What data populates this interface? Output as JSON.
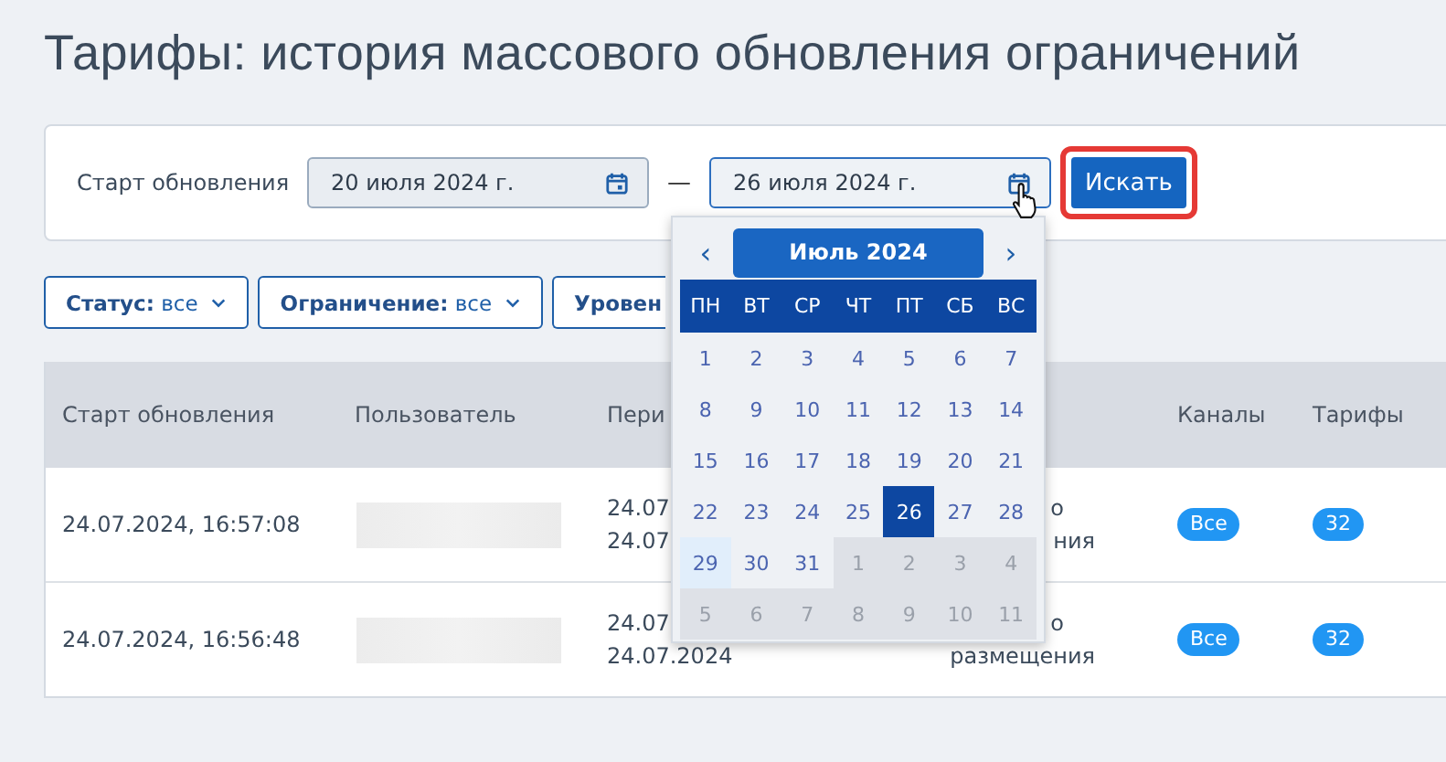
{
  "title": "Тарифы: история массового обновления ограничений",
  "search": {
    "label": "Старт обновления",
    "from": "20 июля 2024 г.",
    "to": "26 июля 2024 г.",
    "to_focused": true,
    "dash": "—",
    "button": "Искать",
    "button_highlighted": true
  },
  "filters": [
    {
      "label": "Статус:",
      "value": "все"
    },
    {
      "label": "Ограничение:",
      "value": "все"
    },
    {
      "label": "Уровен"
    }
  ],
  "table": {
    "columns": [
      "Старт обновления",
      "Пользователь",
      "Пери",
      "",
      "Каналы",
      "Тарифы"
    ],
    "rows": [
      {
        "start": "24.07.2024, 16:57:08",
        "user_blurred": true,
        "period": [
          "24.07",
          "24.07"
        ],
        "restriction": [
          "о",
          "ния"
        ],
        "channels": "Все",
        "tariffs": "32"
      },
      {
        "start": "24.07.2024, 16:56:48",
        "user_blurred": true,
        "period": [
          "24.07",
          "24.07.2024"
        ],
        "restriction": [
          "о",
          "размещения"
        ],
        "channels": "Все",
        "tariffs": "32"
      }
    ]
  },
  "calendar": {
    "prev": "‹",
    "month": "Июль 2024",
    "next": "›",
    "weekdays": [
      "ПН",
      "ВТ",
      "СР",
      "ЧТ",
      "ПТ",
      "СБ",
      "ВС"
    ],
    "weeks": [
      [
        {
          "day": "1",
          "outside": false,
          "selected": false,
          "today": false
        },
        {
          "day": "2",
          "outside": false,
          "selected": false,
          "today": false
        },
        {
          "day": "3",
          "outside": false,
          "selected": false,
          "today": false
        },
        {
          "day": "4",
          "outside": false,
          "selected": false,
          "today": false
        },
        {
          "day": "5",
          "outside": false,
          "selected": false,
          "today": false
        },
        {
          "day": "6",
          "outside": false,
          "selected": false,
          "today": false
        },
        {
          "day": "7",
          "outside": false,
          "selected": false,
          "today": false
        }
      ],
      [
        {
          "day": "8",
          "outside": false,
          "selected": false,
          "today": false
        },
        {
          "day": "9",
          "outside": false,
          "selected": false,
          "today": false
        },
        {
          "day": "10",
          "outside": false,
          "selected": false,
          "today": false
        },
        {
          "day": "11",
          "outside": false,
          "selected": false,
          "today": false
        },
        {
          "day": "12",
          "outside": false,
          "selected": false,
          "today": false
        },
        {
          "day": "13",
          "outside": false,
          "selected": false,
          "today": false
        },
        {
          "day": "14",
          "outside": false,
          "selected": false,
          "today": false
        }
      ],
      [
        {
          "day": "15",
          "outside": false,
          "selected": false,
          "today": false
        },
        {
          "day": "16",
          "outside": false,
          "selected": false,
          "today": false
        },
        {
          "day": "17",
          "outside": false,
          "selected": false,
          "today": false
        },
        {
          "day": "18",
          "outside": false,
          "selected": false,
          "today": false
        },
        {
          "day": "19",
          "outside": false,
          "selected": false,
          "today": false
        },
        {
          "day": "20",
          "outside": false,
          "selected": false,
          "today": false
        },
        {
          "day": "21",
          "outside": false,
          "selected": false,
          "today": false
        }
      ],
      [
        {
          "day": "22",
          "outside": false,
          "selected": false,
          "today": false
        },
        {
          "day": "23",
          "outside": false,
          "selected": false,
          "today": false
        },
        {
          "day": "24",
          "outside": false,
          "selected": false,
          "today": false
        },
        {
          "day": "25",
          "outside": false,
          "selected": false,
          "today": false
        },
        {
          "day": "26",
          "outside": false,
          "selected": true,
          "today": false
        },
        {
          "day": "27",
          "outside": false,
          "selected": false,
          "today": false
        },
        {
          "day": "28",
          "outside": false,
          "selected": false,
          "today": false
        }
      ],
      [
        {
          "day": "29",
          "outside": false,
          "selected": false,
          "today": true
        },
        {
          "day": "30",
          "outside": false,
          "selected": false,
          "today": false
        },
        {
          "day": "31",
          "outside": false,
          "selected": false,
          "today": false
        },
        {
          "day": "1",
          "outside": true,
          "selected": false,
          "today": false
        },
        {
          "day": "2",
          "outside": true,
          "selected": false,
          "today": false
        },
        {
          "day": "3",
          "outside": true,
          "selected": false,
          "today": false
        },
        {
          "day": "4",
          "outside": true,
          "selected": false,
          "today": false
        }
      ],
      [
        {
          "day": "5",
          "outside": true,
          "selected": false,
          "today": false
        },
        {
          "day": "6",
          "outside": true,
          "selected": false,
          "today": false
        },
        {
          "day": "7",
          "outside": true,
          "selected": false,
          "today": false
        },
        {
          "day": "8",
          "outside": true,
          "selected": false,
          "today": false
        },
        {
          "day": "9",
          "outside": true,
          "selected": false,
          "today": false
        },
        {
          "day": "10",
          "outside": true,
          "selected": false,
          "today": false
        },
        {
          "day": "11",
          "outside": true,
          "selected": false,
          "today": false
        }
      ]
    ]
  }
}
